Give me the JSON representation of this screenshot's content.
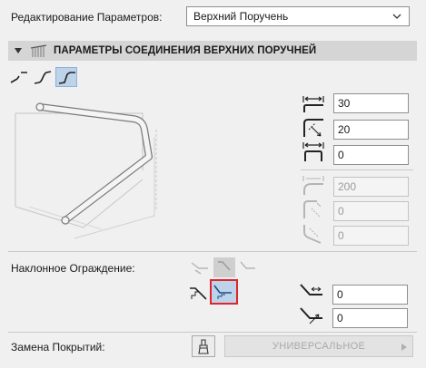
{
  "edit_params": {
    "label": "Редактирование Параметров:",
    "selected": "Верхний Поручень"
  },
  "section": {
    "title": "ПАРАМЕТРЫ СОЕДИНЕНИЯ ВЕРХНИХ ПОРУЧНЕЙ",
    "icon": "railing-icon"
  },
  "connection_modes": {
    "items": [
      "straight-connection-icon",
      "curved-connection-icon",
      "bent-connection-icon"
    ],
    "selected_index": 2
  },
  "fields": {
    "extension_top": {
      "value": "30",
      "icon": "horizontal-extension-icon"
    },
    "offset_diagonal": {
      "value": "20",
      "icon": "diagonal-offset-icon"
    },
    "extension_bottom": {
      "value": "0",
      "icon": "horizontal-post-extension-icon"
    },
    "radius": {
      "value": "200",
      "icon": "radius-icon"
    },
    "corner_offset_1": {
      "value": "0",
      "icon": "corner-offset-icon"
    },
    "corner_offset_2": {
      "value": "0",
      "icon": "corner-offset-2-icon"
    }
  },
  "sloped_railing": {
    "label": "Наклонное Ограждение:",
    "stair_options_selected_index": 1,
    "top_options": [
      "slope-up-icon",
      "slope-flat-icon",
      "slope-down-icon"
    ],
    "field_1": {
      "value": "0",
      "icon": "slope-horizontal-icon"
    },
    "field_2": {
      "value": "0",
      "icon": "slope-diagonal-icon"
    }
  },
  "cover_replace": {
    "label": "Замена Покрытий:",
    "brush_icon": "brush-icon",
    "button_label": "УНИВЕРСАЛЬНОЕ"
  }
}
